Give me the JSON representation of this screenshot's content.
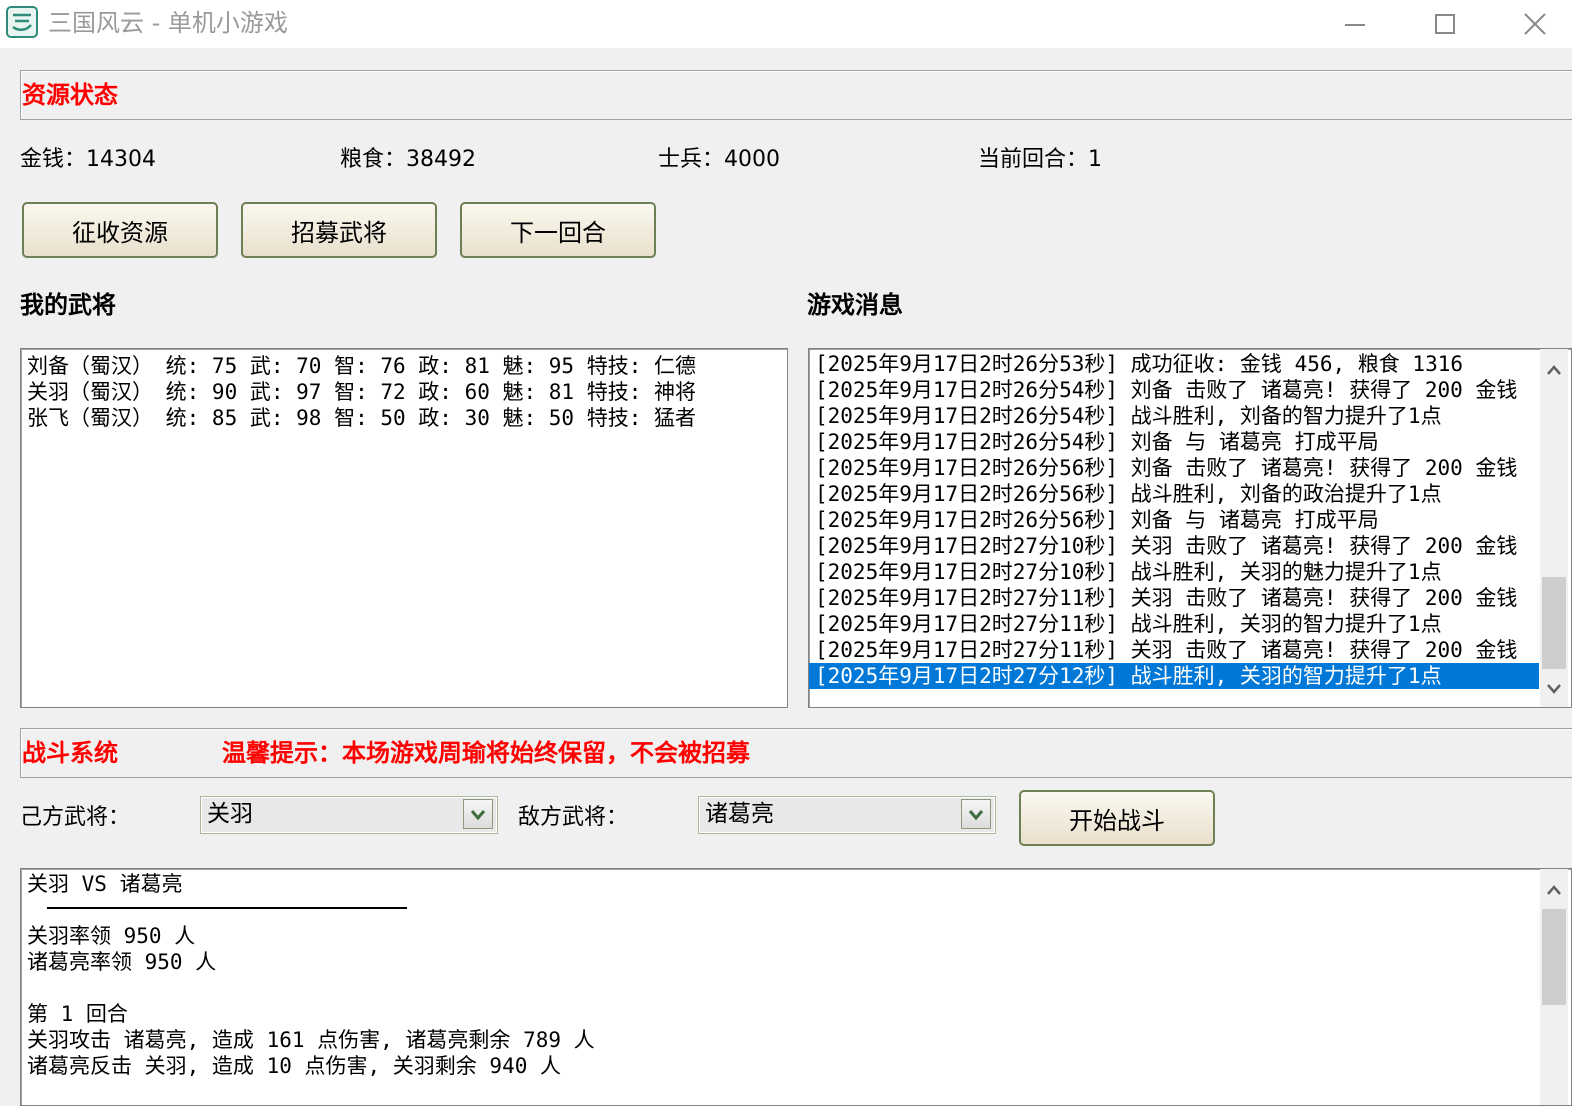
{
  "window": {
    "title": "三国风云 - 单机小游戏"
  },
  "resources": {
    "section_title": "资源状态",
    "money_label": "金钱：",
    "money": "14304",
    "food_label": "粮食：",
    "food": "38492",
    "soldiers_label": "士兵：",
    "soldiers": "4000",
    "round_label": "当前回合：",
    "round": "1"
  },
  "actions": {
    "collect": "征收资源",
    "recruit": "招募武将",
    "next_round": "下一回合"
  },
  "generals": {
    "title": "我的武将",
    "items": [
      "刘备（蜀汉） 统: 75 武: 70 智: 76 政: 81 魅: 95 特技: 仁德",
      "关羽（蜀汉） 统: 90 武: 97 智: 72 政: 60 魅: 81 特技: 神将",
      "张飞（蜀汉） 统: 85 武: 98 智: 50 政: 30 魅: 50 特技: 猛者"
    ]
  },
  "messages": {
    "title": "游戏消息",
    "items": [
      "[2025年9月17日2时26分53秒] 成功征收: 金钱 456, 粮食 1316",
      "[2025年9月17日2时26分54秒] 刘备 击败了 诸葛亮! 获得了 200 金钱",
      "[2025年9月17日2时26分54秒] 战斗胜利, 刘备的智力提升了1点",
      "[2025年9月17日2时26分54秒] 刘备 与 诸葛亮 打成平局",
      "[2025年9月17日2时26分56秒] 刘备 击败了 诸葛亮! 获得了 200 金钱",
      "[2025年9月17日2时26分56秒] 战斗胜利, 刘备的政治提升了1点",
      "[2025年9月17日2时26分56秒] 刘备 与 诸葛亮 打成平局",
      "[2025年9月17日2时27分10秒] 关羽 击败了 诸葛亮! 获得了 200 金钱",
      "[2025年9月17日2时27分10秒] 战斗胜利, 关羽的魅力提升了1点",
      "[2025年9月17日2时27分11秒] 关羽 击败了 诸葛亮! 获得了 200 金钱",
      "[2025年9月17日2时27分11秒] 战斗胜利, 关羽的智力提升了1点",
      "[2025年9月17日2时27分11秒] 关羽 击败了 诸葛亮! 获得了 200 金钱",
      "[2025年9月17日2时27分12秒] 战斗胜利, 关羽的智力提升了1点"
    ],
    "selected_index": 12
  },
  "battle": {
    "section_title": "战斗系统",
    "tip": "温馨提示：本场游戏周瑜将始终保留，不会被招募",
    "own_label": "己方武将：",
    "own_selected": "关羽",
    "enemy_label": "敌方武将：",
    "enemy_selected": "诸葛亮",
    "start_button": "开始战斗",
    "log": [
      "关羽 VS 诸葛亮",
      "",
      "关羽率领 950 人",
      "诸葛亮率领 950 人",
      "",
      "第 1 回合",
      "关羽攻击 诸葛亮, 造成 161 点伤害, 诸葛亮剩余 789 人",
      "诸葛亮反击 关羽, 造成 10 点伤害, 关羽剩余 940 人"
    ]
  },
  "colors": {
    "accent_red": "#ff0000",
    "selection_blue": "#0078d7",
    "button_border": "#6d7f54"
  }
}
